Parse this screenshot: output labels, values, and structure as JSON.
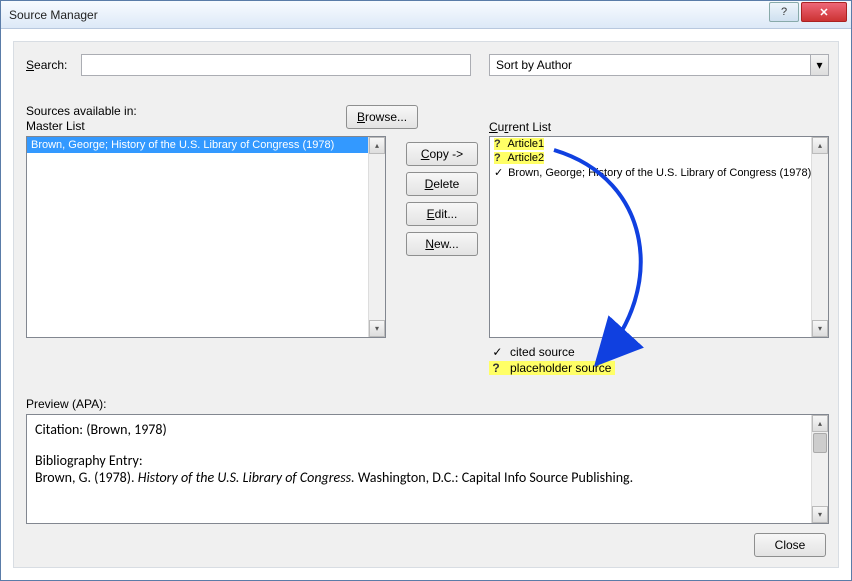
{
  "window": {
    "title": "Source Manager"
  },
  "search": {
    "label": "Search:",
    "value": ""
  },
  "sort": {
    "selected": "Sort by Author"
  },
  "sources_available_label": "Sources available in:",
  "master_list_label": "Master List",
  "browse_label": "Browse...",
  "current_list_label": "Current List",
  "buttons": {
    "copy": "Copy ->",
    "delete": "Delete",
    "edit": "Edit...",
    "new": "New..."
  },
  "master_list": {
    "items": [
      {
        "text": "Brown, George; History of the U.S. Library of Congress (1978)",
        "selected": true
      }
    ]
  },
  "current_list": {
    "items": [
      {
        "marker": "?",
        "text": "Article1",
        "highlight": true
      },
      {
        "marker": "?",
        "text": "Article2",
        "highlight": true
      },
      {
        "marker": "✓",
        "text": "Brown, George; History of the U.S. Library of Congress (1978)",
        "highlight": false
      }
    ]
  },
  "legend": {
    "cited": {
      "marker": "✓",
      "text": "cited source"
    },
    "placeholder": {
      "marker": "?",
      "text": "placeholder source"
    }
  },
  "preview": {
    "label": "Preview (APA):",
    "citation_label": "Citation:",
    "citation_value": "(Brown, 1978)",
    "bib_label": "Bibliography Entry:",
    "bib_author": "Brown, G. (1978). ",
    "bib_title": "History of the U.S. Library of Congress.",
    "bib_rest": " Washington, D.C.: Capital Info Source Publishing."
  },
  "close_label": "Close"
}
